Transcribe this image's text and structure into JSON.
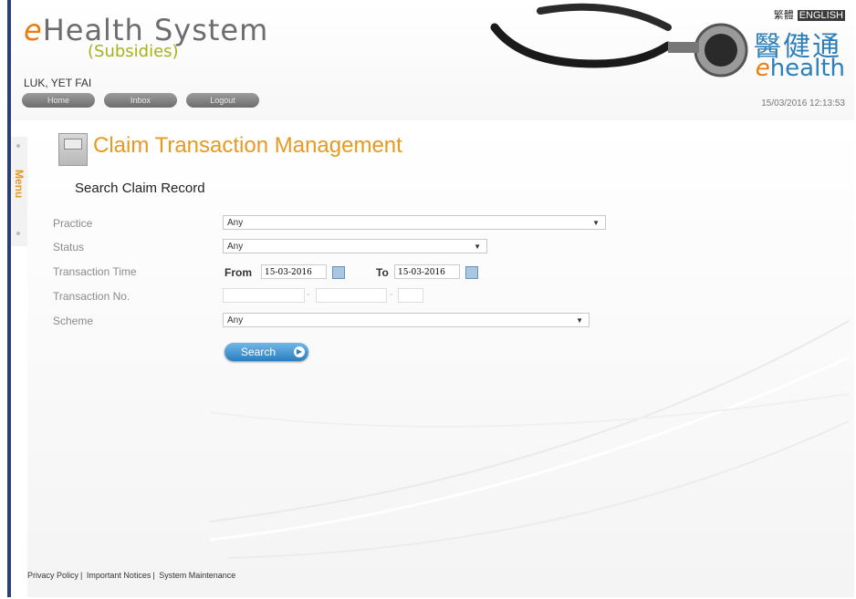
{
  "header": {
    "logo_e": "e",
    "logo_text": "Health System",
    "logo_sub": "(Subsidies)",
    "username": "LUK, YET FAI",
    "nav": [
      "Home",
      "Inbox",
      "Logout"
    ],
    "lang_tc": "繁體",
    "lang_en": "ENGLISH",
    "brand_cn": "醫健通",
    "brand_e": "e",
    "brand_en": "health",
    "datetime": "15/03/2016 12:13:53"
  },
  "menu": {
    "label": "Menu"
  },
  "page": {
    "title": "Claim Transaction Management",
    "subtitle": "Search Claim Record"
  },
  "form": {
    "practice_label": "Practice",
    "practice_value": "Any",
    "status_label": "Status",
    "status_value": "Any",
    "time_label": "Transaction Time",
    "from_label": "From",
    "from_value": "15-03-2016",
    "to_label": "To",
    "to_value": "15-03-2016",
    "txno_label": "Transaction No.",
    "scheme_label": "Scheme",
    "scheme_value": "Any",
    "search_label": "Search"
  },
  "footer": {
    "links": [
      "Privacy Policy",
      "Important Notices",
      "System Maintenance"
    ]
  },
  "colors": {
    "accent": "#e69a1f",
    "brand_blue": "#2c7fb8",
    "frame": "#2a3f73"
  }
}
